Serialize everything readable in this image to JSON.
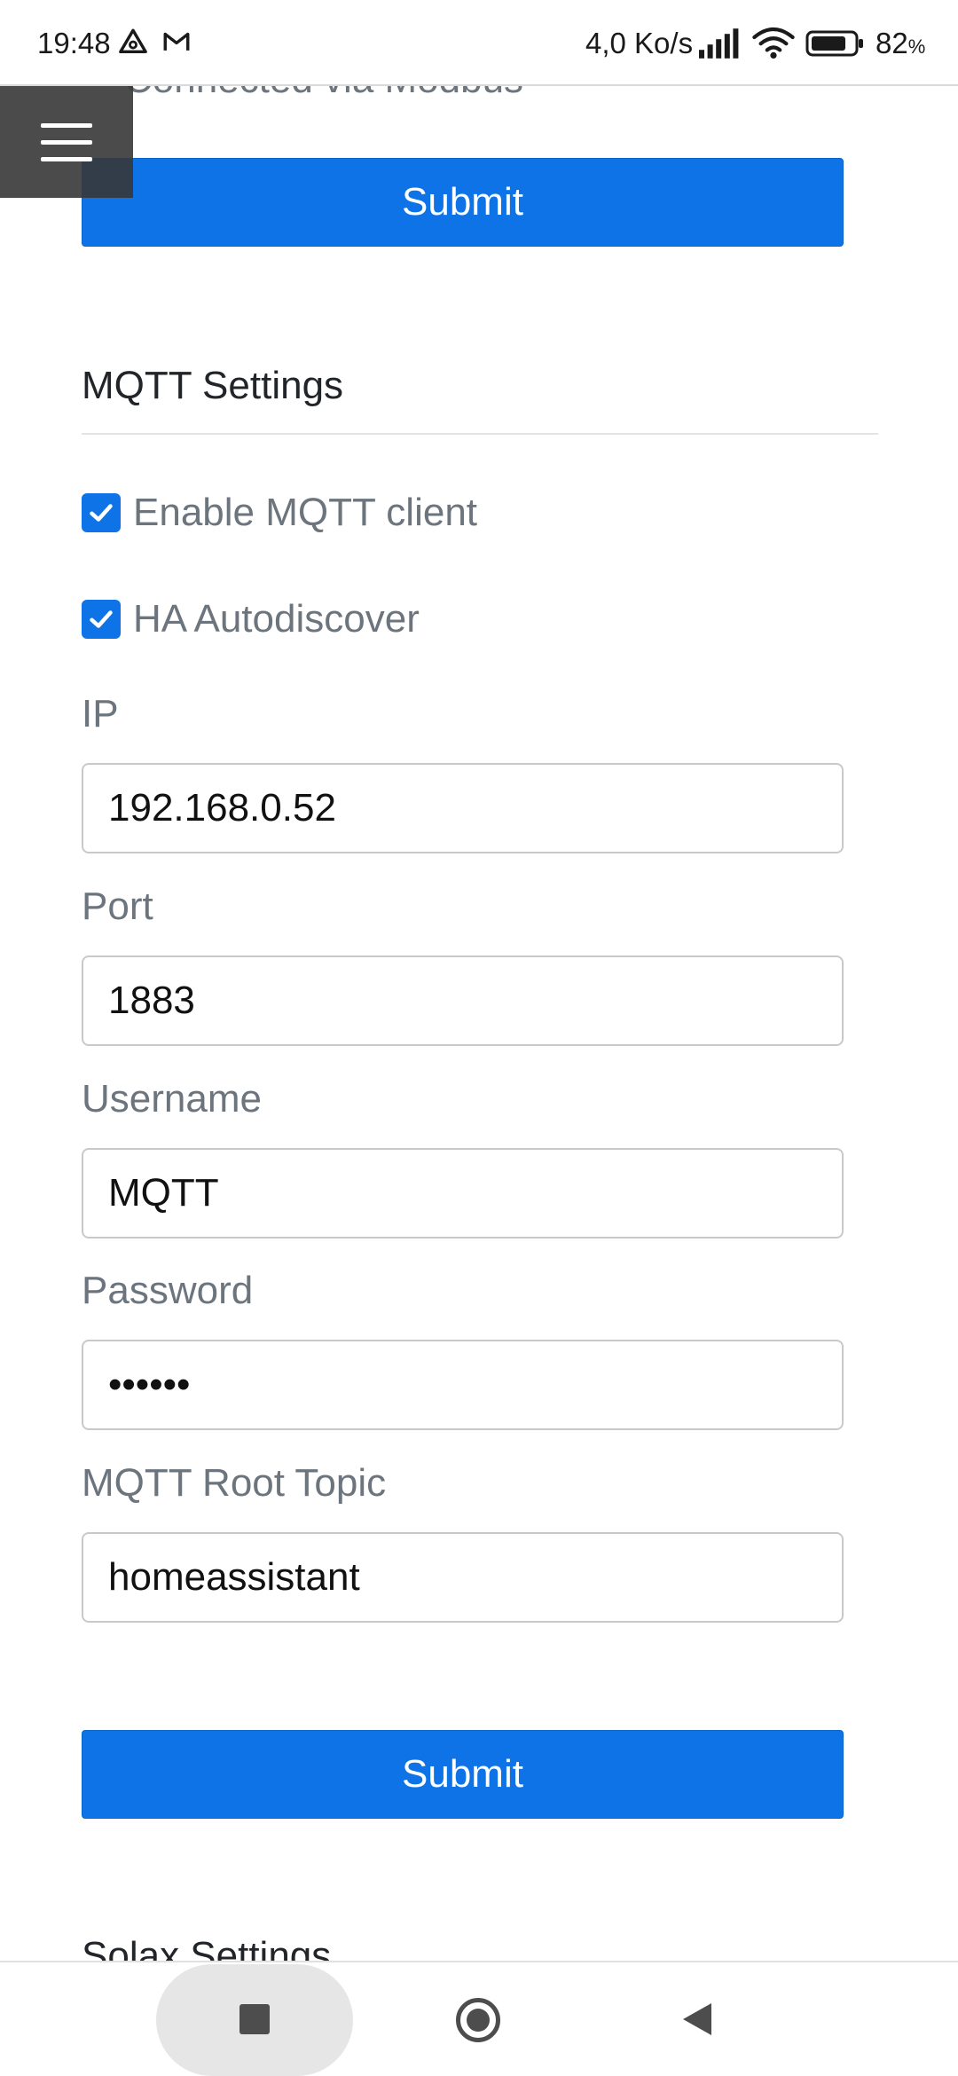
{
  "status_bar": {
    "time": "19:48",
    "speed": "4,0 Ko/s",
    "battery_percent": "82",
    "battery_unit": "%",
    "battery_level": 0.82
  },
  "clipped_label": "Connected via Modbus",
  "top_submit_label": "Submit",
  "mqtt": {
    "title": "MQTT Settings",
    "enable_label": "Enable MQTT client",
    "enable_checked": true,
    "ha_label": "HA Autodiscover",
    "ha_checked": true,
    "ip_label": "IP",
    "ip_value": "192.168.0.52",
    "port_label": "Port",
    "port_value": "1883",
    "username_label": "Username",
    "username_value": "MQTT",
    "password_label": "Password",
    "password_value": "••••••",
    "topic_label": "MQTT Root Topic",
    "topic_value": "homeassistant",
    "submit_label": "Submit"
  },
  "next_section_title": "Solax Settings",
  "colors": {
    "primary": "#0d73e6",
    "label": "#6c757d"
  }
}
